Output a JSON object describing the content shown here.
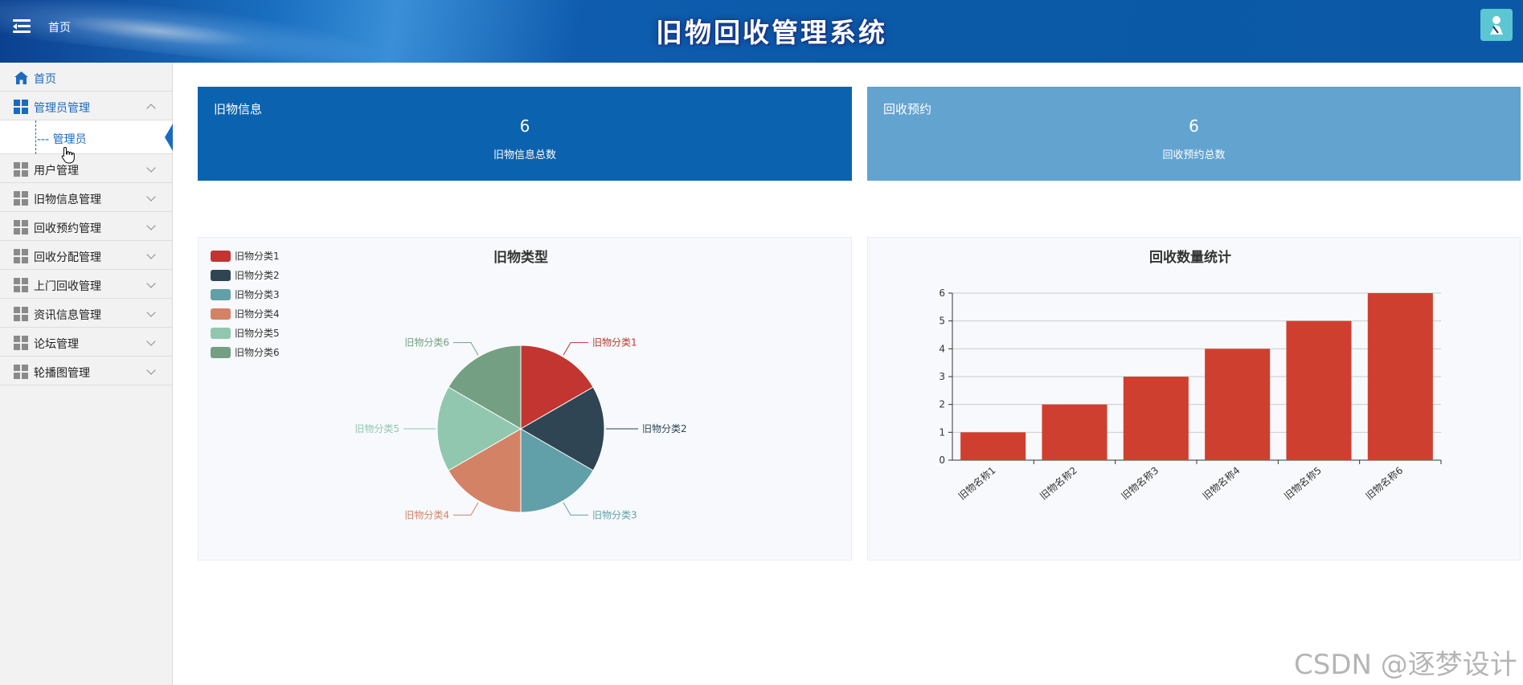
{
  "header": {
    "home_label": "首页",
    "title": "旧物回收管理系统"
  },
  "sidebar": {
    "items": [
      {
        "label": "首页",
        "icon": "home-icon",
        "expanded": false
      },
      {
        "label": "管理员管理",
        "icon": "grid-icon",
        "expanded": true,
        "children": [
          {
            "label": "--- 管理员"
          }
        ]
      },
      {
        "label": "用户管理",
        "icon": "grid-icon",
        "expanded": false
      },
      {
        "label": "旧物信息管理",
        "icon": "grid-icon",
        "expanded": false
      },
      {
        "label": "回收预约管理",
        "icon": "grid-icon",
        "expanded": false
      },
      {
        "label": "回收分配管理",
        "icon": "grid-icon",
        "expanded": false
      },
      {
        "label": "上门回收管理",
        "icon": "grid-icon",
        "expanded": false
      },
      {
        "label": "资讯信息管理",
        "icon": "grid-icon",
        "expanded": false
      },
      {
        "label": "论坛管理",
        "icon": "grid-icon",
        "expanded": false
      },
      {
        "label": "轮播图管理",
        "icon": "grid-icon",
        "expanded": false
      }
    ]
  },
  "cards": [
    {
      "title": "旧物信息",
      "value": "6",
      "subtitle": "旧物信息总数",
      "color": "#0b63b0"
    },
    {
      "title": "回收预约",
      "value": "6",
      "subtitle": "回收预约总数",
      "color": "#63a3d0"
    }
  ],
  "chart_data": [
    {
      "type": "pie",
      "title": "旧物类型",
      "legend_position": "top-left",
      "categories": [
        "旧物分类1",
        "旧物分类2",
        "旧物分类3",
        "旧物分类4",
        "旧物分类5",
        "旧物分类6"
      ],
      "values": [
        1,
        1,
        1,
        1,
        1,
        1
      ],
      "colors": [
        "#c23531",
        "#2f4554",
        "#61a0a8",
        "#d48265",
        "#91c7ae",
        "#749f83"
      ]
    },
    {
      "type": "bar",
      "title": "回收数量统计",
      "categories": [
        "旧物名称1",
        "旧物名称2",
        "旧物名称3",
        "旧物名称4",
        "旧物名称5",
        "旧物名称6"
      ],
      "values": [
        1,
        2,
        3,
        4,
        5,
        6
      ],
      "ylim": [
        0,
        6
      ],
      "yticks": [
        "0",
        "1",
        "2",
        "3",
        "4",
        "5",
        "6"
      ],
      "grid": true,
      "color": "#cf3f2f"
    }
  ],
  "watermark": "CSDN @逐梦设计"
}
